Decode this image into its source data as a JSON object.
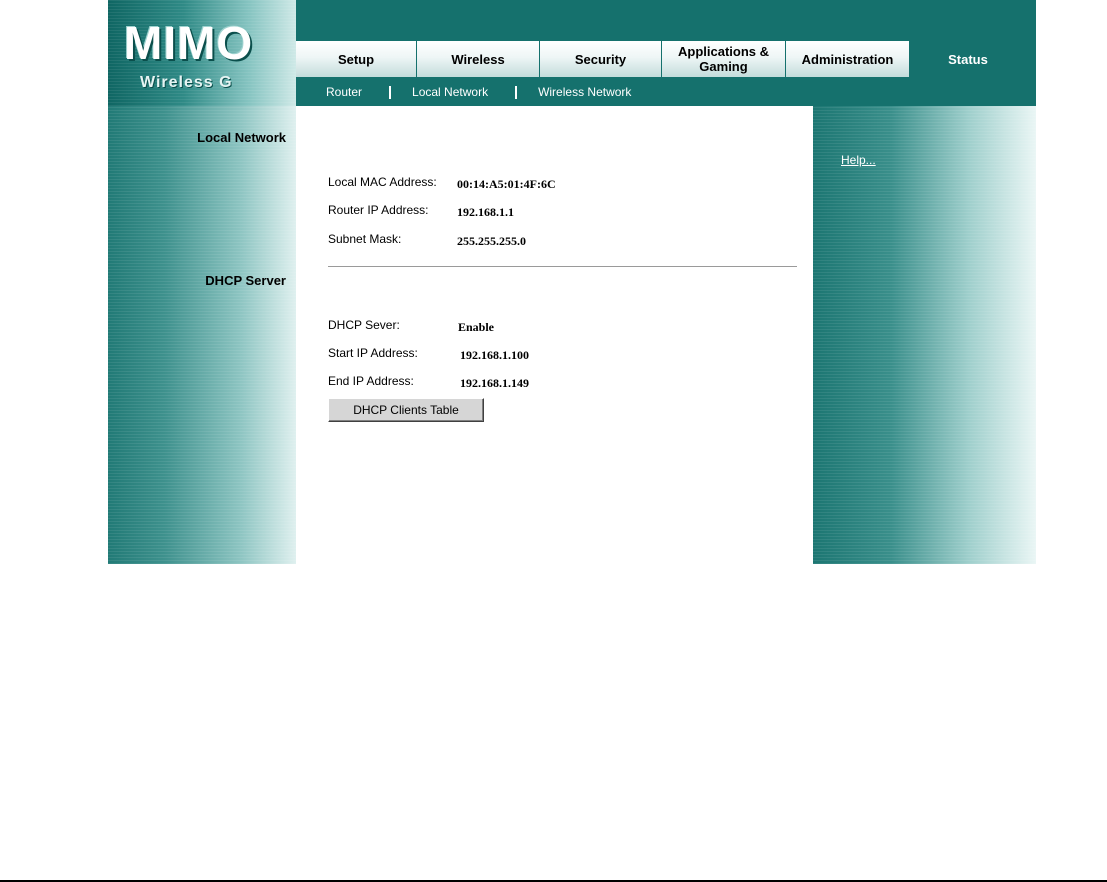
{
  "logo": {
    "main": "MIMO",
    "sub": "Wireless G"
  },
  "tabs": [
    {
      "label": "Setup"
    },
    {
      "label": "Wireless"
    },
    {
      "label": "Security"
    },
    {
      "label": "Applications & Gaming"
    },
    {
      "label": "Administration"
    },
    {
      "label": "Status",
      "active": true
    }
  ],
  "subnav": [
    {
      "label": "Router"
    },
    {
      "label": "Local Network",
      "active": true
    },
    {
      "label": "Wireless Network"
    }
  ],
  "sections": {
    "local_network": "Local Network",
    "dhcp_server": "DHCP Server"
  },
  "local_network": {
    "mac": {
      "label": "Local MAC Address:",
      "value": "00:14:A5:01:4F:6C"
    },
    "ip": {
      "label": "Router IP Address:",
      "value": "192.168.1.1"
    },
    "mask": {
      "label": "Subnet Mask:",
      "value": "255.255.255.0"
    }
  },
  "dhcp": {
    "server": {
      "label": "DHCP Sever:",
      "value": "Enable"
    },
    "start": {
      "label": "Start IP Address:",
      "value": "192.168.1.100"
    },
    "end": {
      "label": "End IP Address:",
      "value": "192.168.1.149"
    },
    "clients_button": "DHCP Clients Table"
  },
  "help": {
    "label": "Help..."
  },
  "colors": {
    "header": "#15716d",
    "tab_bg": "#ffffff",
    "accent_text": "#ffffff"
  }
}
